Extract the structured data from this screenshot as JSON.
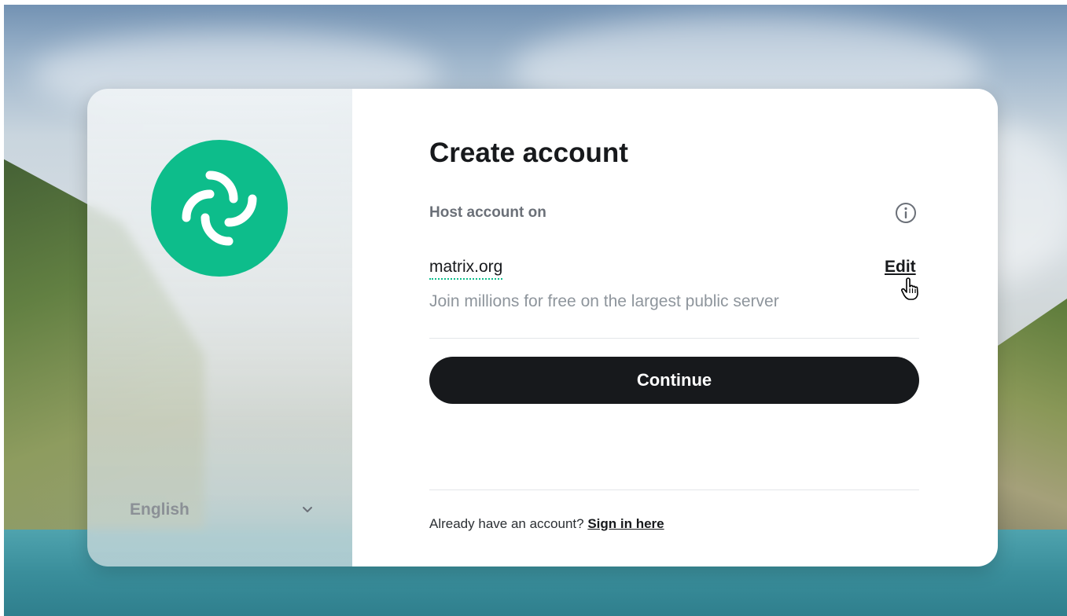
{
  "window": {
    "title": "Create account"
  },
  "sidebar": {
    "logo_icon": "element-logo-icon",
    "brand_color": "#0dbd8b",
    "language": {
      "selected": "English",
      "icon": "chevron-down-icon"
    }
  },
  "form": {
    "title": "Create account",
    "host_label": "Host account on",
    "info_icon": "info-icon",
    "server": {
      "name": "matrix.org",
      "description": "Join millions for free on the largest public server",
      "edit_label": "Edit"
    },
    "continue_label": "Continue",
    "signin_prompt": "Already have an account?",
    "signin_link": "Sign in here"
  },
  "colors": {
    "accent": "#0dbd8b",
    "button_bg": "#17191c",
    "muted_text": "#8e959c"
  }
}
